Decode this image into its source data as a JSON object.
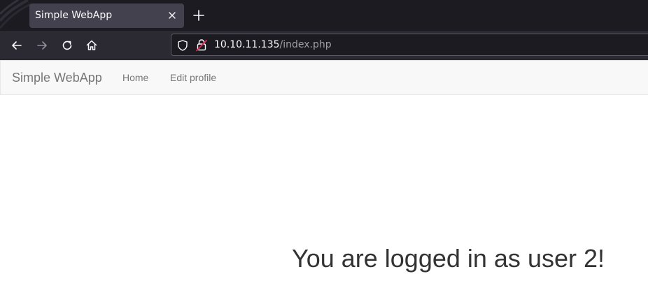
{
  "browser": {
    "tab": {
      "title": "Simple WebApp",
      "close_icon": "close-icon"
    },
    "new_tab_icon": "plus-icon",
    "toolbar": {
      "back_icon": "arrow-left-icon",
      "forward_icon": "arrow-right-icon",
      "reload_icon": "reload-icon",
      "home_icon": "home-icon"
    },
    "urlbar": {
      "host": "10.10.11.135",
      "path": "/index.php",
      "shield_icon": "shield-icon",
      "insecure_icon": "insecure-lock-icon"
    },
    "colors": {
      "tabstrip_bg": "#1c1b22",
      "toolbar_bg": "#2b2a33",
      "tab_bg": "#42414d",
      "insecure_accent": "#e22850"
    }
  },
  "navbar": {
    "brand": "Simple WebApp",
    "links": [
      {
        "label": "Home"
      },
      {
        "label": "Edit profile"
      }
    ]
  },
  "main": {
    "message": "You are logged in as user 2!"
  }
}
